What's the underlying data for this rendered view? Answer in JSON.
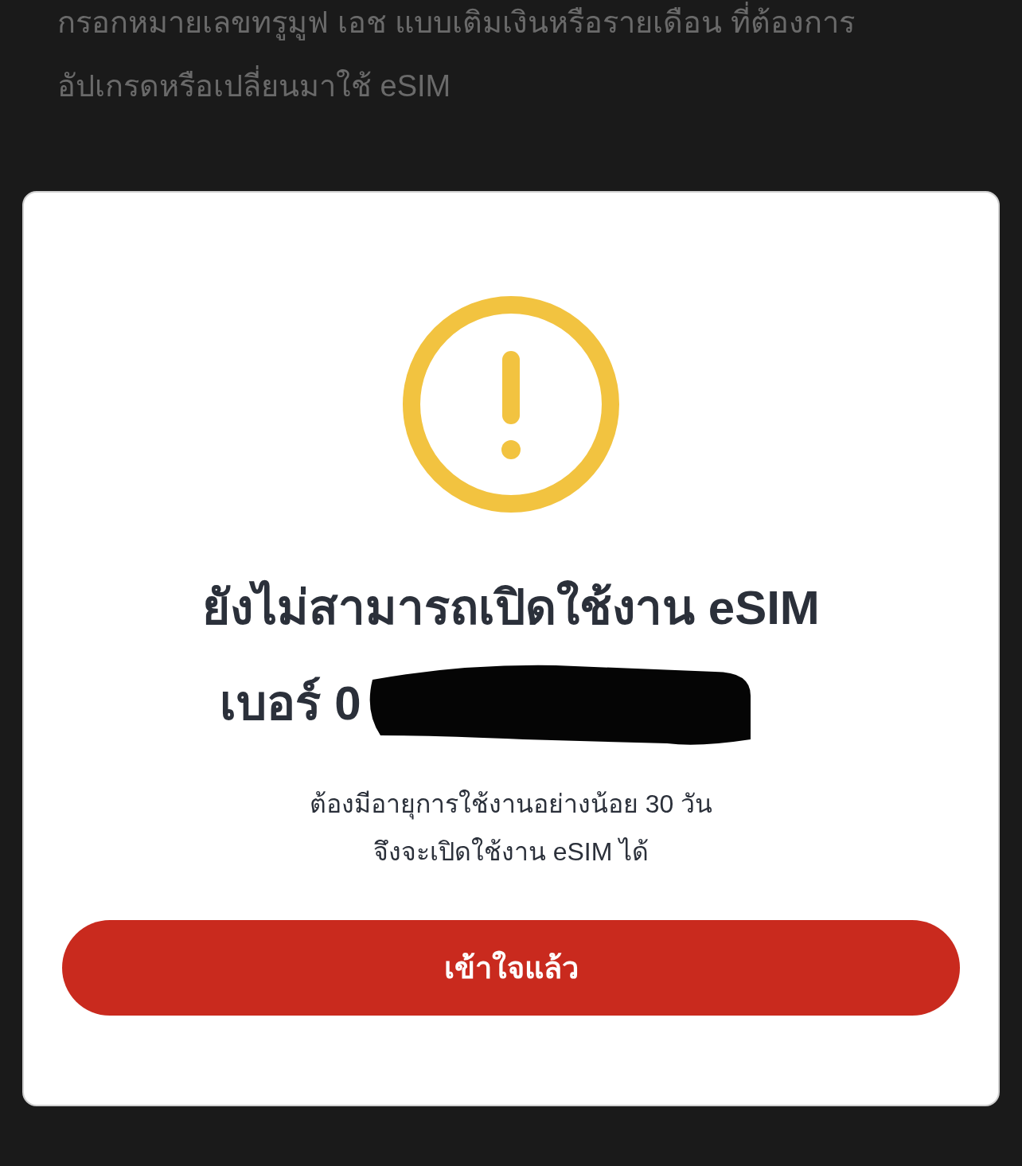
{
  "background": {
    "lines": [
      "กรอกหมายเลขทรูมูฟ เอช แบบเติมเงินหรือรายเดือน ที่ต้องการ",
      "อัปเกรดหรือเปลี่ยนมาใช้ eSIM"
    ]
  },
  "dialog": {
    "title": "ยังไม่สามารถเปิดใช้งาน eSIM",
    "number_label": "เบอร์ 0",
    "message_lines": [
      "ต้องมีอายุการใช้งานอย่างน้อย 30 วัน",
      "จึงจะเปิดใช้งาน eSIM ได้"
    ],
    "button": "เข้าใจแล้ว"
  }
}
